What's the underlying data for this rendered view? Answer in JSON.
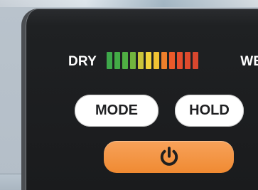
{
  "device": {
    "scale": {
      "left_label": "DRY",
      "right_label": "WET",
      "segments": [
        {
          "color": "#3ea84a"
        },
        {
          "color": "#43ab46"
        },
        {
          "color": "#4faf43"
        },
        {
          "color": "#72b53e"
        },
        {
          "color": "#c9c43a"
        },
        {
          "color": "#f0d33b"
        },
        {
          "color": "#f0c233"
        },
        {
          "color": "#ee7f2b"
        },
        {
          "color": "#ea5a2a"
        },
        {
          "color": "#e44d2d"
        },
        {
          "color": "#df4a2d"
        },
        {
          "color": "#d9472e"
        }
      ]
    },
    "buttons": {
      "mode_label": "MODE",
      "hold_label": "HOLD",
      "power_icon": "power-icon"
    },
    "colors": {
      "device_body": "#1f2123",
      "button_fill": "#ffffff",
      "power_button": "#f08a32"
    }
  }
}
